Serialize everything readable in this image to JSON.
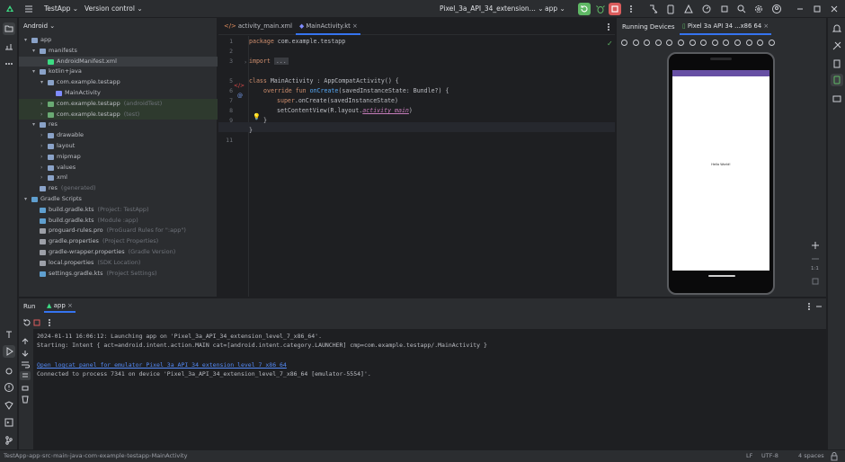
{
  "titlebar": {
    "project": "TestApp",
    "vcs": "Version control",
    "device": "Pixel_3a_API_34_extension...",
    "config": "app"
  },
  "project_panel": {
    "view": "Android",
    "nodes": [
      {
        "label": "app",
        "hint": ""
      },
      {
        "label": "manifests",
        "hint": ""
      },
      {
        "label": "AndroidManifest.xml",
        "hint": ""
      },
      {
        "label": "kotlin+java",
        "hint": ""
      },
      {
        "label": "com.example.testapp",
        "hint": ""
      },
      {
        "label": "MainActivity",
        "hint": ""
      },
      {
        "label": "com.example.testapp",
        "hint": "(androidTest)"
      },
      {
        "label": "com.example.testapp",
        "hint": "(test)"
      },
      {
        "label": "res",
        "hint": ""
      },
      {
        "label": "drawable",
        "hint": ""
      },
      {
        "label": "layout",
        "hint": ""
      },
      {
        "label": "mipmap",
        "hint": ""
      },
      {
        "label": "values",
        "hint": ""
      },
      {
        "label": "xml",
        "hint": ""
      },
      {
        "label": "res",
        "hint": "(generated)"
      },
      {
        "label": "Gradle Scripts",
        "hint": ""
      },
      {
        "label": "build.gradle.kts",
        "hint": "(Project: TestApp)"
      },
      {
        "label": "build.gradle.kts",
        "hint": "(Module :app)"
      },
      {
        "label": "proguard-rules.pro",
        "hint": "(ProGuard Rules for \":app\")"
      },
      {
        "label": "gradle.properties",
        "hint": "(Project Properties)"
      },
      {
        "label": "gradle-wrapper.properties",
        "hint": "(Gradle Version)"
      },
      {
        "label": "local.properties",
        "hint": "(SDK Location)"
      },
      {
        "label": "settings.gradle.kts",
        "hint": "(Project Settings)"
      }
    ]
  },
  "editor": {
    "tabs": [
      "activity_main.xml",
      "MainActivity.kt"
    ],
    "line_numbers": [
      "1",
      "2",
      "3",
      "5",
      "6",
      "7",
      "8",
      "9",
      "10",
      "11"
    ],
    "code": {
      "l1_kw": "package",
      "l1_rest": " com.example.testapp",
      "l3_kw": "import",
      "l3_fold": "...",
      "l6_kw": "class",
      "l6_rest": " MainActivity : AppCompatActivity() {",
      "l7_kw": "override fun",
      "l7_fn": " onCreate",
      "l7_rest": "(savedInstanceState: Bundle?) {",
      "l8_kw": "super",
      "l8_rest": ".onCreate(savedInstanceState)",
      "l9_rest": "setContentView(R.layout.",
      "l9_pur": "activity_main",
      "l9_end": ")",
      "l10": "}",
      "l11": "}"
    }
  },
  "devices": {
    "title": "Running Devices",
    "tab": "Pixel 3a API 34 ...x86 64",
    "screen_text": "Hello World!",
    "zoom_label": "1:1"
  },
  "run": {
    "title": "Run",
    "tab": "app",
    "lines": [
      "2024-01-11 16:06:12: Launching app on 'Pixel_3a_API_34_extension_level_7_x86_64'.",
      "Starting: Intent { act=android.intent.action.MAIN cat=[android.intent.category.LAUNCHER] cmp=com.example.testapp/.MainActivity }",
      "Open logcat panel for emulator Pixel 3a API 34 extension level 7 x86 64",
      "Connected to process 7341 on device 'Pixel_3a_API_34_extension_level_7_x86_64 [emulator-5554]'."
    ]
  },
  "status": {
    "crumbs": [
      "TestApp",
      "app",
      "src",
      "main",
      "java",
      "com",
      "example",
      "testapp",
      "MainActivity"
    ],
    "line_sep": "LF",
    "encoding": "UTF-8",
    "indent": "4 spaces"
  },
  "colors": {
    "accent": "#3574f0",
    "run_green": "#5fb865",
    "stop_red": "#db5c5c"
  }
}
